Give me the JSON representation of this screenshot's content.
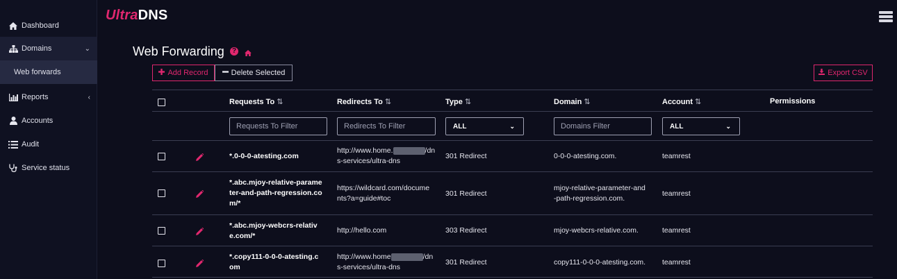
{
  "brand": {
    "part1": "Ultra",
    "part2": "DNS"
  },
  "sidebar": {
    "items": [
      {
        "label": "Dashboard",
        "icon": "home-icon"
      },
      {
        "label": "Domains",
        "icon": "sitemap-icon",
        "chevron": "⌄"
      },
      {
        "label": "Web forwards"
      },
      {
        "label": "Reports",
        "icon": "bar-chart-icon",
        "chevron": "‹"
      },
      {
        "label": "Accounts",
        "icon": "user-icon"
      },
      {
        "label": "Audit",
        "icon": "list-icon"
      },
      {
        "label": "Service status",
        "icon": "stethoscope-icon"
      }
    ]
  },
  "page": {
    "title": "Web Forwarding",
    "help": "?"
  },
  "toolbar": {
    "add_label": "Add Record",
    "delete_label": "Delete Selected",
    "export_label": "Export CSV"
  },
  "table": {
    "columns": [
      {
        "label": "Requests To",
        "sort": "⇅"
      },
      {
        "label": "Redirects To",
        "sort": "⇅"
      },
      {
        "label": "Type",
        "sort": "⇅"
      },
      {
        "label": "Domain",
        "sort": "⇅"
      },
      {
        "label": "Account",
        "sort": "⇅"
      },
      {
        "label": "Permissions"
      }
    ],
    "filters": {
      "requests_placeholder": "Requests To Filter",
      "redirects_placeholder": "Redirects To Filter",
      "type_value": "ALL",
      "domains_placeholder": "Domains Filter",
      "account_value": "ALL"
    },
    "rows": [
      {
        "requests": [
          "*.0-0-0-atesting.com"
        ],
        "redirects": [
          "http://www.home.",
          "/dn",
          "s-services/ultra-dns"
        ],
        "type": "301 Redirect",
        "domain": [
          "0-0-0-atesting.com."
        ],
        "account": "teamrest"
      },
      {
        "requests": [
          "*.abc.mjoy-relative-parame",
          "ter-and-path-regression.co",
          "m/*"
        ],
        "redirects": [
          "https://wildcard.com/docume",
          "nts?a=guide#toc"
        ],
        "type": "301 Redirect",
        "domain": [
          "mjoy-relative-parameter-and",
          "-path-regression.com."
        ],
        "account": "teamrest"
      },
      {
        "requests": [
          "*.abc.mjoy-webcrs-relativ",
          "e.com/*"
        ],
        "redirects": [
          "http://hello.com"
        ],
        "type": "303 Redirect",
        "domain": [
          "mjoy-webcrs-relative.com."
        ],
        "account": "teamrest"
      },
      {
        "requests": [
          "*.copy111-0-0-0-atesting.c",
          "om"
        ],
        "redirects": [
          "http://www.home",
          "/dn",
          "s-services/ultra-dns"
        ],
        "type": "301 Redirect",
        "domain": [
          "copy111-0-0-0-atesting.com."
        ],
        "account": "teamrest"
      }
    ]
  },
  "colors": {
    "accent": "#e0276e",
    "background": "#0d0e1c",
    "sidebar": "#0f1121"
  }
}
